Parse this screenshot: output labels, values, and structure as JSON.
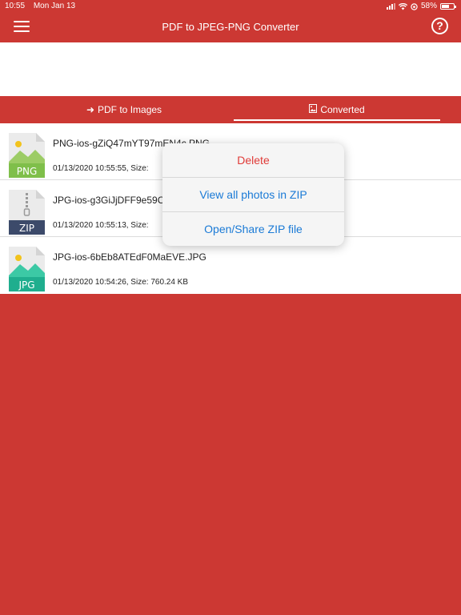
{
  "status": {
    "time": "10:55",
    "date": "Mon Jan 13",
    "battery": "58%"
  },
  "navbar": {
    "title": "PDF to JPEG-PNG Converter",
    "help_label": "?"
  },
  "tabs": [
    {
      "label": "PDF to Images",
      "selected": false
    },
    {
      "label": "Converted",
      "selected": true
    }
  ],
  "files": [
    {
      "name": "PNG-ios-gZiQ47mYT97mEN4c.PNG",
      "info": "01/13/2020 10:55:55, Size:",
      "type": "PNG",
      "color": "#7fbf4a"
    },
    {
      "name": "JPG-ios-g3GiJjDFF9e59C",
      "info": "01/13/2020 10:55:13, Size:",
      "type": "ZIP",
      "color": "#3c4a6a"
    },
    {
      "name": "JPG-ios-6bEb8ATEdF0MaEVE.JPG",
      "info": "01/13/2020 10:54:26, Size: 760.24 KB",
      "type": "JPG",
      "color": "#1fae8e"
    }
  ],
  "popup": {
    "delete": "Delete",
    "view_zip": "View all photos in ZIP",
    "open_share": "Open/Share ZIP file"
  },
  "colors": {
    "brand": "#cc3833",
    "link": "#1a7ad6",
    "danger": "#e03a37"
  }
}
